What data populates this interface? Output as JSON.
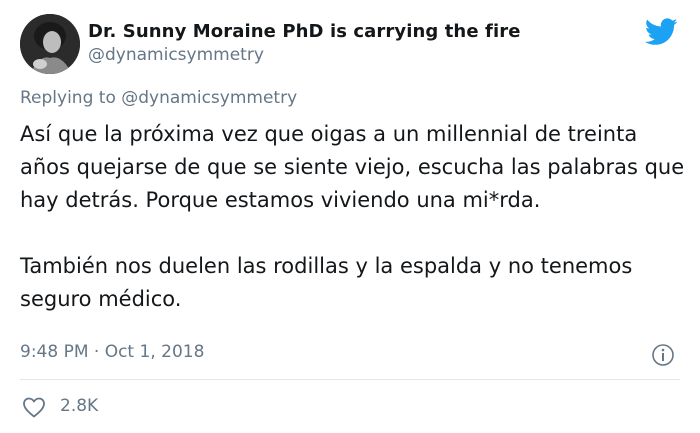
{
  "tweet": {
    "display_name": "Dr. Sunny Moraine PhD is carrying the fire",
    "handle": "@dynamicsymmetry",
    "reply_prefix": "Replying to",
    "reply_to": "@dynamicsymmetry",
    "text_paragraphs": [
      "Así que la próxima vez que oigas a un millennial de treinta años quejarse de que se siente viejo, escucha las palabras que hay detrás. Porque estamos viviendo una mi*rda.",
      "También nos duelen las rodillas y la espalda y no tenemos seguro médico."
    ],
    "timestamp": "9:48 PM · Oct 1, 2018",
    "like_count": "2.8K"
  },
  "colors": {
    "twitter_blue": "#1da1f2",
    "secondary_text": "#657786",
    "primary_text": "#14171a"
  },
  "icons": [
    "twitter-bird-icon",
    "info-icon",
    "heart-icon"
  ]
}
